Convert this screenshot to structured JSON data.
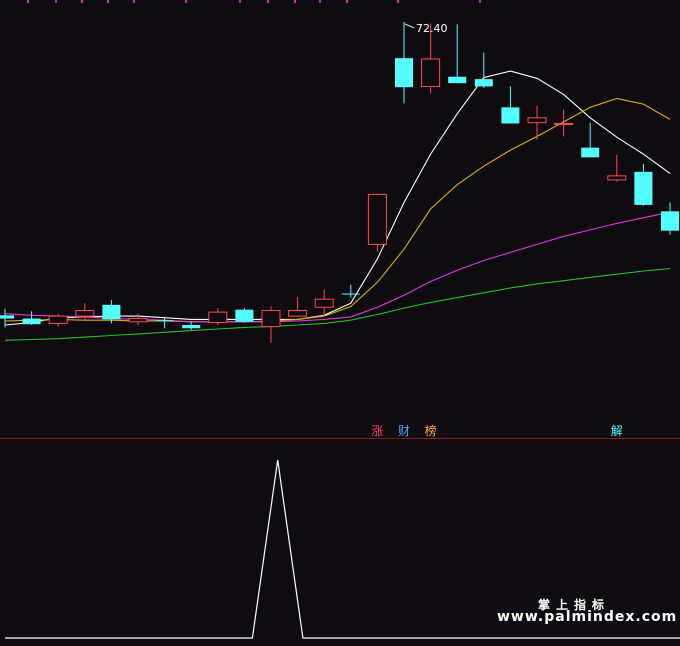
{
  "chart_data": [
    {
      "type": "candlestick",
      "title": "",
      "x_count": 26,
      "ylim": [
        25,
        74
      ],
      "price_label": "72.40",
      "up_color": "#ff4a4a",
      "down_color": "#54ffff",
      "grid": false,
      "candles": [
        {
          "open": 36.0,
          "high": 36.8,
          "low": 34.5,
          "close": 35.6
        },
        {
          "open": 35.6,
          "high": 36.5,
          "low": 34.8,
          "close": 34.9
        },
        {
          "open": 35.0,
          "high": 36.2,
          "low": 34.6,
          "close": 35.9
        },
        {
          "open": 35.9,
          "high": 37.5,
          "low": 35.4,
          "close": 36.6
        },
        {
          "open": 37.3,
          "high": 37.9,
          "low": 35.0,
          "close": 35.5
        },
        {
          "open": 35.2,
          "high": 36.2,
          "low": 34.8,
          "close": 35.6
        },
        {
          "open": 35.4,
          "high": 35.8,
          "low": 34.4,
          "close": 35.3
        },
        {
          "open": 34.8,
          "high": 35.3,
          "low": 34.2,
          "close": 34.4
        },
        {
          "open": 35.1,
          "high": 36.9,
          "low": 34.8,
          "close": 36.4
        },
        {
          "open": 36.7,
          "high": 36.9,
          "low": 35.1,
          "close": 35.2
        },
        {
          "open": 34.6,
          "high": 37.1,
          "low": 32.6,
          "close": 36.6
        },
        {
          "open": 35.9,
          "high": 38.3,
          "low": 35.8,
          "close": 36.6
        },
        {
          "open": 37.0,
          "high": 39.2,
          "low": 35.9,
          "close": 38.0
        },
        {
          "open": 38.7,
          "high": 39.8,
          "low": 38.2,
          "close": 38.6
        },
        {
          "open": 44.8,
          "high": 51.1,
          "low": 43.9,
          "close": 51.0
        },
        {
          "open": 67.9,
          "high": 72.4,
          "low": 62.3,
          "close": 64.3
        },
        {
          "open": 64.4,
          "high": 72.2,
          "low": 63.5,
          "close": 67.8
        },
        {
          "open": 65.6,
          "high": 72.1,
          "low": 64.9,
          "close": 64.8
        },
        {
          "open": 65.3,
          "high": 68.6,
          "low": 64.2,
          "close": 64.4
        },
        {
          "open": 61.8,
          "high": 64.4,
          "low": 59.8,
          "close": 59.8
        },
        {
          "open": 59.9,
          "high": 62.0,
          "low": 57.8,
          "close": 60.5
        },
        {
          "open": 59.8,
          "high": 61.5,
          "low": 58.2,
          "close": 59.8
        },
        {
          "open": 56.8,
          "high": 59.9,
          "low": 55.8,
          "close": 55.6
        },
        {
          "open": 52.8,
          "high": 55.9,
          "low": 52.6,
          "close": 53.3
        },
        {
          "open": 53.8,
          "high": 54.8,
          "low": 49.6,
          "close": 49.7
        },
        {
          "open": 48.9,
          "high": 50.0,
          "low": 46.0,
          "close": 46.5
        }
      ],
      "series": [
        {
          "color": "#ffffff",
          "values": [
            34.8,
            35.1,
            35.7,
            35.8,
            35.9,
            35.9,
            35.7,
            35.5,
            35.5,
            35.5,
            35.5,
            35.5,
            36.0,
            37.5,
            43.0,
            50.0,
            56.0,
            61.0,
            65.5,
            66.3,
            65.4,
            63.4,
            60.5,
            58.1,
            56.0,
            53.6
          ]
        },
        {
          "color": "#d9b000",
          "values": [
            35.3,
            35.4,
            35.5,
            35.4,
            35.4,
            35.3,
            35.3,
            35.2,
            35.2,
            35.2,
            35.3,
            35.5,
            35.9,
            37.1,
            40.1,
            44.2,
            49.2,
            52.2,
            54.5,
            56.5,
            58.2,
            60.0,
            61.8,
            62.9,
            62.2,
            60.3
          ]
        },
        {
          "color": "#e437e4",
          "values": [
            36.2,
            36.0,
            35.9,
            35.8,
            35.6,
            35.5,
            35.4,
            35.2,
            35.2,
            35.2,
            35.2,
            35.3,
            35.5,
            35.8,
            37.0,
            38.5,
            40.2,
            41.6,
            42.8,
            43.8,
            44.8,
            45.8,
            46.6,
            47.4,
            48.1,
            48.8
          ]
        },
        {
          "color": "#27c027",
          "values": [
            32.9,
            33.0,
            33.1,
            33.3,
            33.5,
            33.7,
            33.9,
            34.1,
            34.3,
            34.5,
            34.6,
            34.8,
            35.0,
            35.4,
            36.1,
            36.9,
            37.6,
            38.2,
            38.8,
            39.4,
            39.9,
            40.3,
            40.7,
            41.1,
            41.5,
            41.8
          ]
        }
      ],
      "signals": [
        {
          "index": 14,
          "text": "涨",
          "color": "#ff4a4a"
        },
        {
          "index": 15,
          "text": "财",
          "color": "#5aa0ff"
        },
        {
          "index": 16,
          "text": "榜",
          "color": "#ffb040"
        },
        {
          "index": 23,
          "text": "解",
          "color": "#54ffff"
        }
      ],
      "overlay_line": {
        "color": "#ffffff",
        "points": [
          [
            0.0,
            0.0
          ],
          [
            9.3,
            0.0
          ],
          [
            10.25,
            1.0
          ],
          [
            11.2,
            0.0
          ],
          [
            20.5,
            0.0
          ]
        ]
      }
    },
    {
      "type": "line",
      "ylim": [
        0,
        1
      ],
      "series": [
        {
          "color": "#ffffff",
          "x": [
            0,
            9.3,
            10.25,
            11.2,
            25.5
          ],
          "values": [
            0,
            0,
            1,
            0,
            0
          ]
        }
      ]
    }
  ],
  "watermark": {
    "line1": "掌上指标",
    "line2": "www.palmindex.com"
  }
}
